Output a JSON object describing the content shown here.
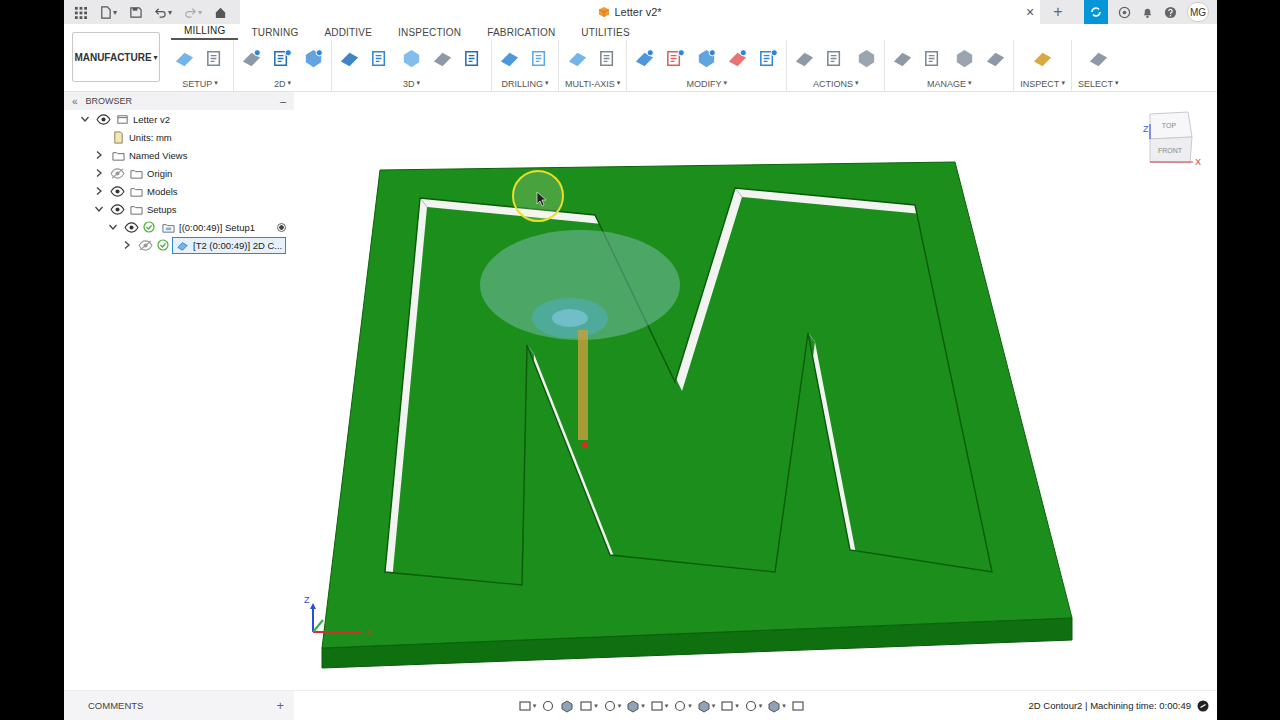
{
  "app": {
    "title": "Letter v2*",
    "close": "×",
    "new_tab": "+",
    "user": "MG",
    "caret": "▾"
  },
  "ribbon": {
    "workspace": "MANUFACTURE",
    "workspace_caret": "▾",
    "tabs": [
      {
        "label": "MILLING",
        "selected": true
      },
      {
        "label": "TURNING",
        "selected": false
      },
      {
        "label": "ADDITIVE",
        "selected": false
      },
      {
        "label": "INSPECTION",
        "selected": false
      },
      {
        "label": "FABRICATION",
        "selected": false
      },
      {
        "label": "UTILITIES",
        "selected": false
      }
    ],
    "groups": [
      {
        "label": "SETUP",
        "caret": "▾"
      },
      {
        "label": "2D",
        "caret": "▾"
      },
      {
        "label": "3D",
        "caret": "▾"
      },
      {
        "label": "DRILLING",
        "caret": "▾"
      },
      {
        "label": "MULTI-AXIS",
        "caret": "▾"
      },
      {
        "label": "MODIFY",
        "caret": "▾"
      },
      {
        "label": "ACTIONS",
        "caret": "▾"
      },
      {
        "label": "MANAGE",
        "caret": "▾"
      },
      {
        "label": "INSPECT",
        "caret": "▾"
      },
      {
        "label": "SELECT",
        "caret": "▾"
      }
    ]
  },
  "browser": {
    "title": "BROWSER",
    "collapse": "«",
    "minimize": "–",
    "items": [
      {
        "label": "Letter v2",
        "depth": 0,
        "toggle": true,
        "expanded": true,
        "eye": true,
        "visible": true,
        "checked": false,
        "active": false,
        "selected": false,
        "kind": "document"
      },
      {
        "label": "Units: mm",
        "depth": 1,
        "toggle": false,
        "expanded": false,
        "eye": false,
        "visible": false,
        "checked": false,
        "active": false,
        "selected": false,
        "kind": "units"
      },
      {
        "label": "Named Views",
        "depth": 1,
        "toggle": true,
        "expanded": false,
        "eye": false,
        "visible": false,
        "checked": false,
        "active": false,
        "selected": false,
        "kind": "folder"
      },
      {
        "label": "Origin",
        "depth": 1,
        "toggle": true,
        "expanded": false,
        "eye": true,
        "visible": false,
        "checked": false,
        "active": false,
        "selected": false,
        "kind": "folder"
      },
      {
        "label": "Models",
        "depth": 1,
        "toggle": true,
        "expanded": false,
        "eye": true,
        "visible": true,
        "checked": false,
        "active": false,
        "selected": false,
        "kind": "folder"
      },
      {
        "label": "Setups",
        "depth": 1,
        "toggle": true,
        "expanded": true,
        "eye": true,
        "visible": true,
        "checked": false,
        "active": false,
        "selected": false,
        "kind": "folder"
      },
      {
        "label": "[(0:00:49)] Setup1",
        "depth": 2,
        "toggle": true,
        "expanded": true,
        "eye": true,
        "visible": true,
        "checked": true,
        "active": true,
        "selected": false,
        "kind": "setup"
      },
      {
        "label": "[T2 (0:00:49)] 2D C...",
        "depth": 3,
        "toggle": true,
        "expanded": false,
        "eye": true,
        "visible": false,
        "checked": true,
        "active": false,
        "selected": true,
        "kind": "operation"
      }
    ]
  },
  "viewcube": {
    "top": "TOP",
    "front": "FRONT",
    "z": "Z",
    "x": "X"
  },
  "triad": {
    "z": "Z",
    "x": "X"
  },
  "comments": {
    "label": "COMMENTS",
    "add": "+"
  },
  "status_bar": {
    "text": "2D Contour2 | Machining time: 0:00:49"
  }
}
